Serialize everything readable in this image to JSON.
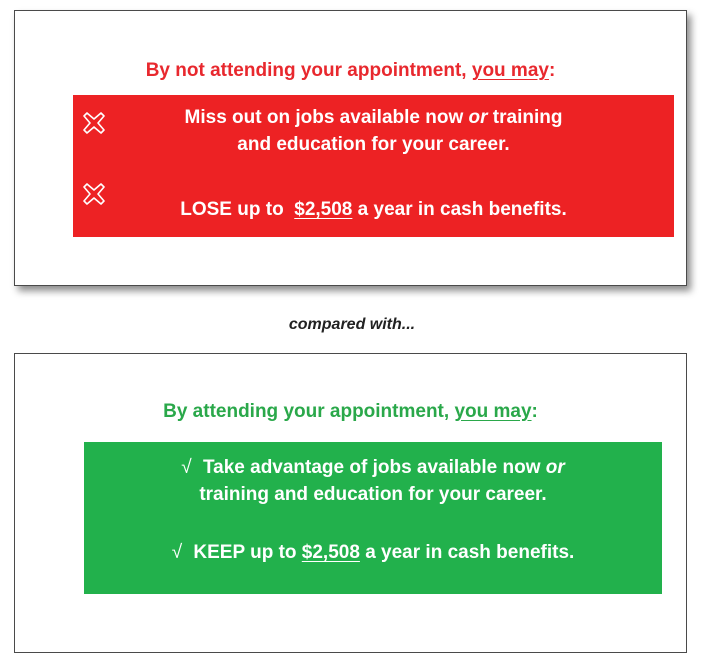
{
  "top_card": {
    "heading_prefix": "By not attending your appointment,",
    "heading_emph": "you may",
    "heading_colon": ":",
    "items": [
      {
        "line1_pre": "Miss out on jobs available now",
        "line1_italic": "or",
        "line1_post": "training",
        "line2": "and education for your career."
      },
      {
        "pre": "LOSE up to",
        "amount": "$2,508",
        "post": "a year in cash benefits."
      }
    ],
    "icon": "x-mark-icon"
  },
  "compared": "compared with...",
  "bottom_card": {
    "heading_prefix": "By attending your appointment,",
    "heading_emph": "you may",
    "heading_colon": ":",
    "check_glyph": "√",
    "items": [
      {
        "line1_pre": "Take advantage of jobs available now",
        "line1_italic": "or",
        "line2": "training and education for your career."
      },
      {
        "pre": "KEEP up to",
        "amount": "$2,508",
        "post": "a year in cash benefits."
      }
    ]
  },
  "colors": {
    "red": "#ed2224",
    "red_text": "#e8282e",
    "green": "#22b14c",
    "green_text": "#2aa84a"
  }
}
